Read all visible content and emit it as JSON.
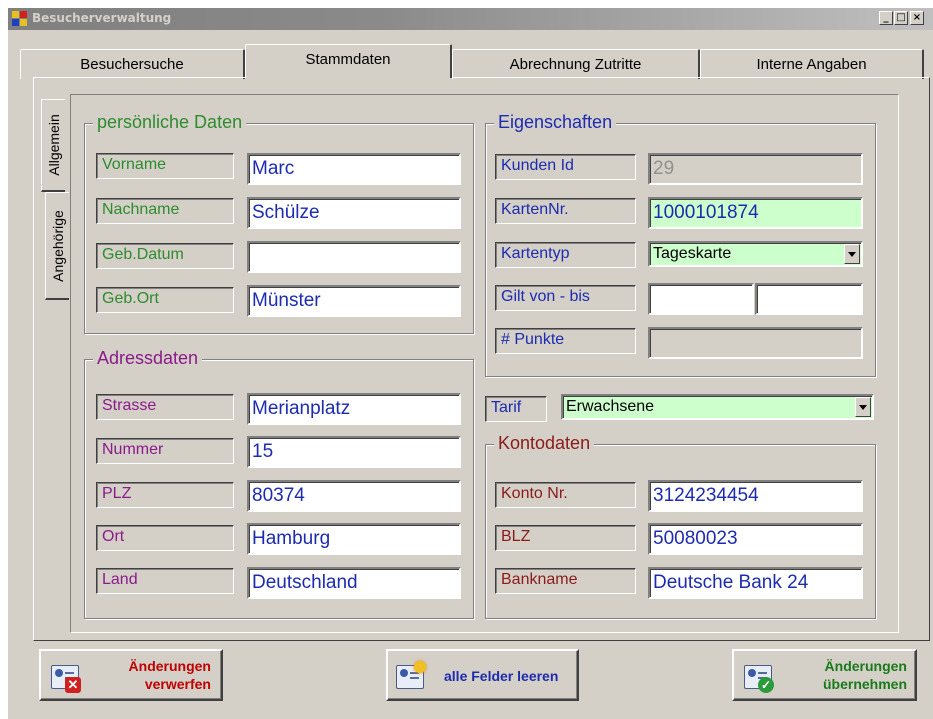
{
  "window": {
    "title": "Besucherverwaltung",
    "min_label": "_",
    "max_label": "□",
    "close_label": "×"
  },
  "tabs": [
    {
      "label": "Besuchersuche"
    },
    {
      "label": "Stammdaten"
    },
    {
      "label": "Abrechnung Zutritte"
    },
    {
      "label": "Interne Angaben"
    }
  ],
  "side_tabs": [
    {
      "label": "Allgemein"
    },
    {
      "label": "Angehörige"
    }
  ],
  "personal": {
    "legend": "persönliche Daten",
    "vorname_label": "Vorname",
    "vorname": "Marc",
    "nachname_label": "Nachname",
    "nachname": "Schülze",
    "gebdatum_label": "Geb.Datum",
    "gebdatum": "",
    "geburtsort_label": "Geb.Ort",
    "geburtsort": "Münster"
  },
  "address": {
    "legend": "Adressdaten",
    "strasse_label": "Strasse",
    "strasse": "Merianplatz",
    "nummer_label": "Nummer",
    "nummer": "15",
    "plz_label": "PLZ",
    "plz": "80374",
    "ort_label": "Ort",
    "ort": "Hamburg",
    "land_label": "Land",
    "land": "Deutschland"
  },
  "properties": {
    "legend": "Eigenschaften",
    "kunden_id_label": "Kunden Id",
    "kunden_id": "29",
    "kartennr_label": "KartenNr.",
    "kartennr": "1000101874",
    "kartentyp_label": "Kartentyp",
    "kartentyp": "Tageskarte",
    "gilt_label": "Gilt von - bis",
    "gilt_von": "",
    "gilt_bis": "",
    "punkte_label": "# Punkte",
    "punkte": ""
  },
  "tarif": {
    "label": "Tarif",
    "value": "Erwachsene"
  },
  "bank": {
    "legend": "Kontodaten",
    "konto_label": "Konto Nr.",
    "konto": "3124234454",
    "blz_label": "BLZ",
    "blz": "50080023",
    "bankname_label": "Bankname",
    "bankname": "Deutsche Bank 24"
  },
  "buttons": {
    "discard_line1": "Änderungen",
    "discard_line2": "verwerfen",
    "clear": "alle Felder leeren",
    "apply_line1": "Änderungen",
    "apply_line2": "übernehmen"
  },
  "colors": {
    "personal_text": "#2e8b2e",
    "address_text": "#8b1a8b",
    "properties_text": "#1c2bb0",
    "bank_text": "#8b1a1a",
    "highlight_field": "#ccffcc"
  }
}
